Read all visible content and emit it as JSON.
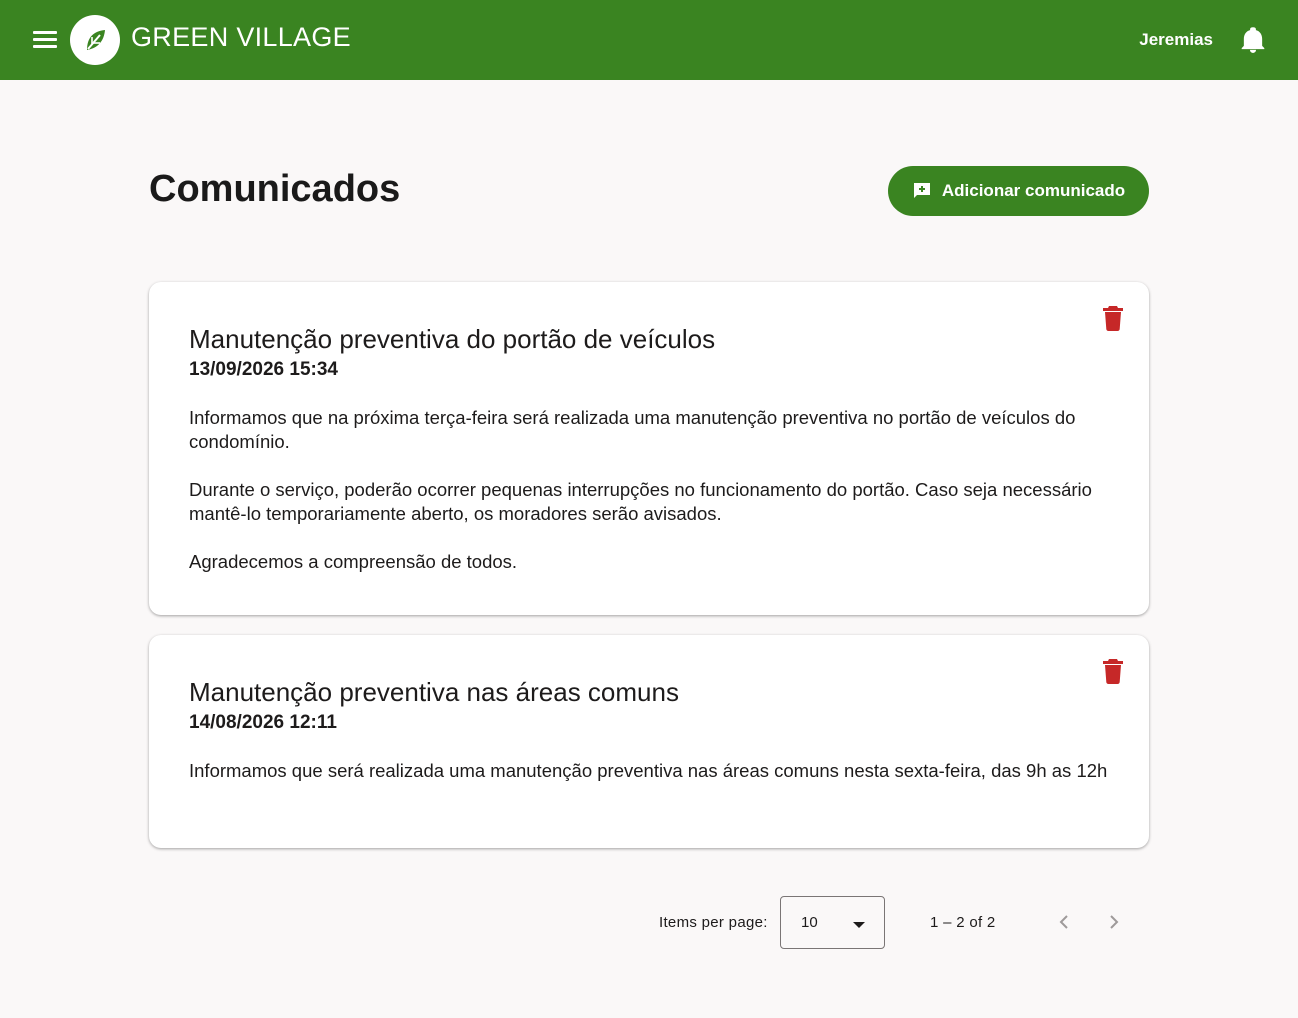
{
  "header": {
    "brand": "GREEN VILLAGE",
    "user": "Jeremias",
    "color": "#3a8421"
  },
  "page": {
    "title": "Comunicados",
    "add_button_label": "Adicionar comunicado"
  },
  "announcements": [
    {
      "title": "Manutenção preventiva do portão de veículos",
      "date": "13/09/2026 15:34",
      "paragraphs": [
        "Informamos que na próxima terça-feira será realizada uma manutenção preventiva no portão de veículos do condomínio.",
        "Durante o serviço, poderão ocorrer pequenas interrupções no funcionamento do portão. Caso seja necessário mantê-lo temporariamente aberto, os moradores serão avisados.",
        "Agradecemos a compreensão de todos."
      ]
    },
    {
      "title": "Manutenção preventiva nas áreas comuns",
      "date": "14/08/2026 12:11",
      "paragraphs": [
        "Informamos que será realizada uma manutenção preventiva nas áreas comuns nesta sexta-feira, das 9h as 12h"
      ]
    }
  ],
  "paginator": {
    "items_per_page_label": "Items per page:",
    "items_per_page_value": "10",
    "range_label": "1 – 2 of 2"
  },
  "icons": {
    "menu": "menu-icon",
    "logo": "leaf-logo-icon",
    "bell": "bell-icon",
    "add": "add-comment-icon",
    "delete": "trash-icon",
    "prev": "chevron-left-icon",
    "next": "chevron-right-icon"
  },
  "colors": {
    "primary": "#3a8421",
    "danger": "#c62828",
    "background": "#faf8f8"
  }
}
